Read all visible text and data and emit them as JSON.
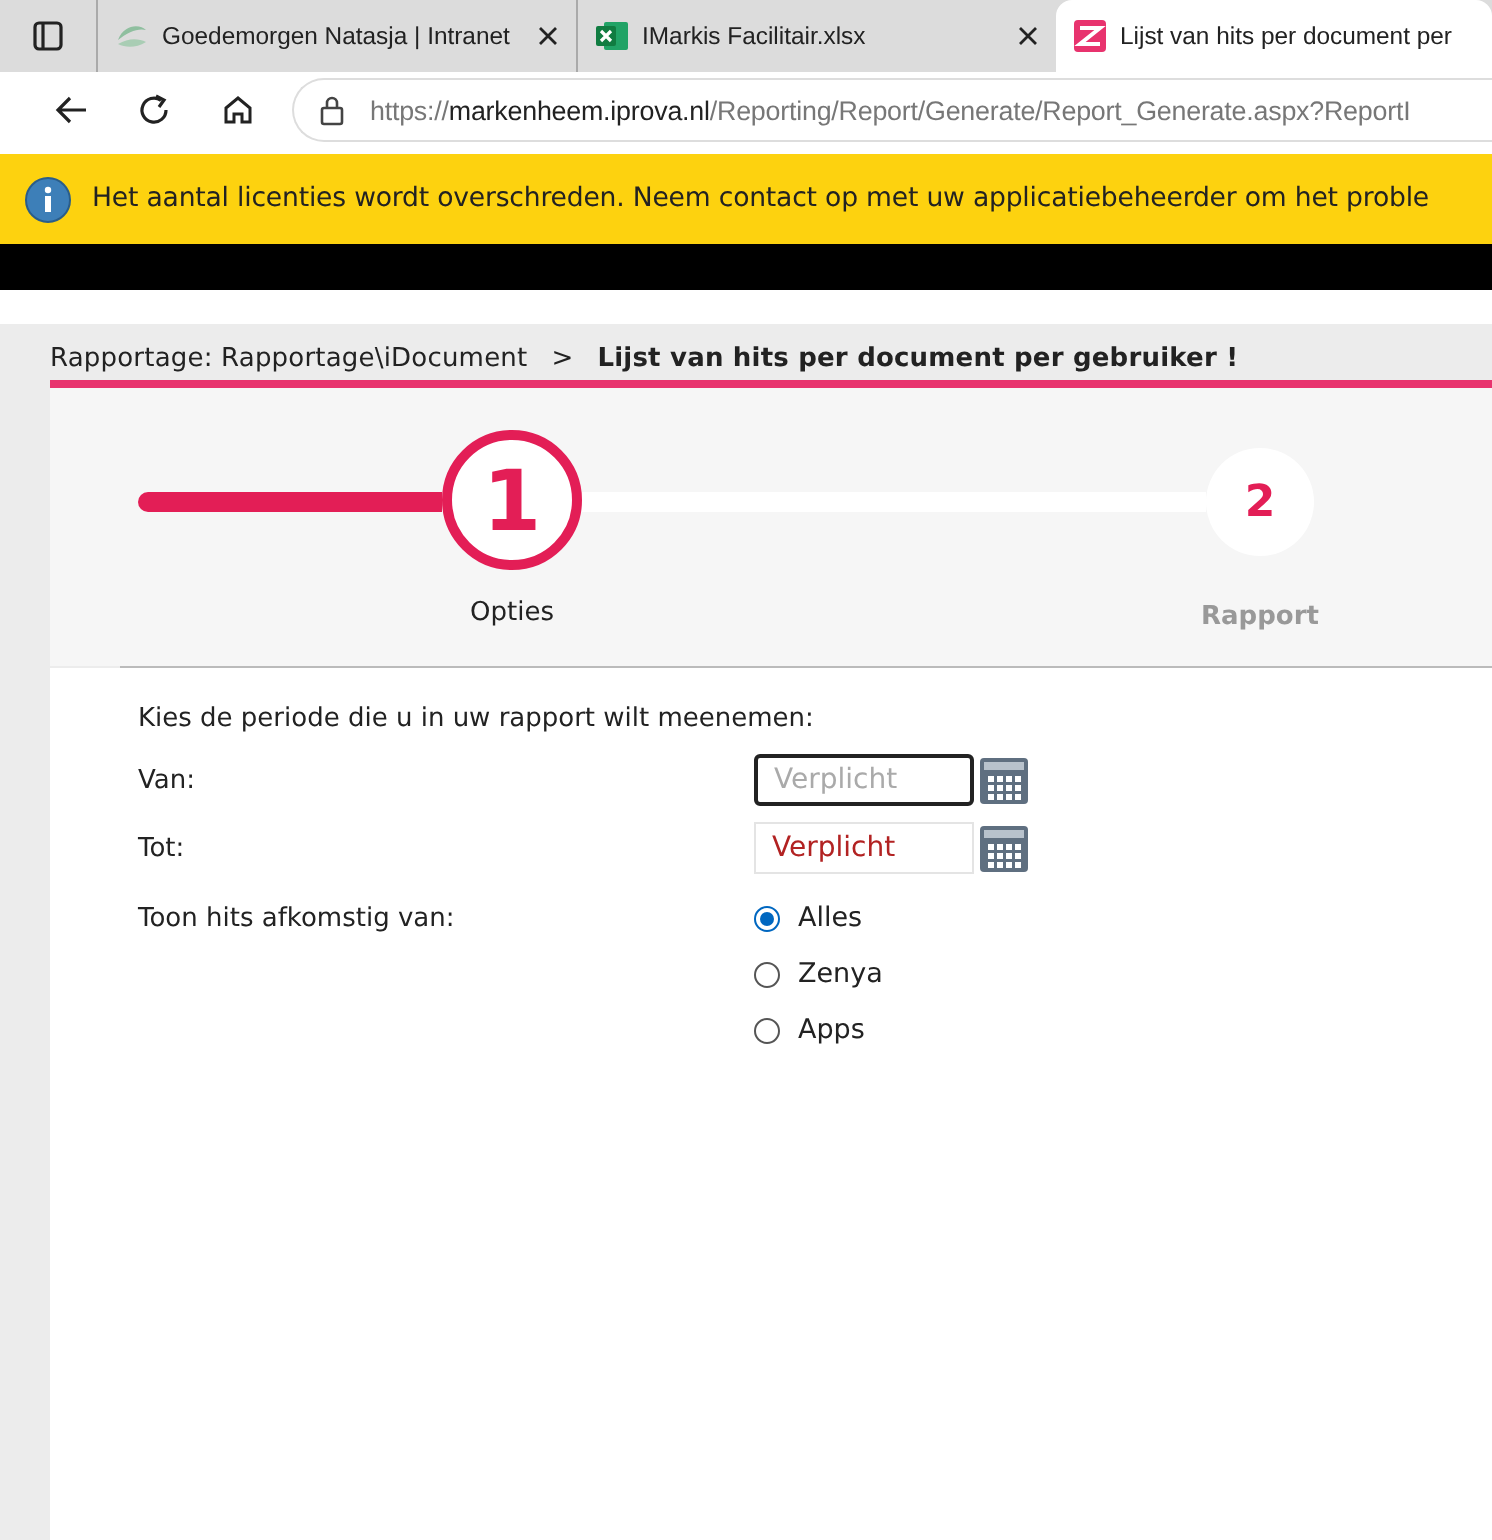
{
  "browser": {
    "tabs": [
      {
        "title": "Goedemorgen Natasja | Intranet",
        "selected": false
      },
      {
        "title": "IMarkis Facilitair.xlsx",
        "selected": false
      },
      {
        "title": "Lijst van hits per document per",
        "selected": true
      }
    ],
    "address": {
      "scheme": "https://",
      "host": "markenheem.iprova.nl",
      "path": "/Reporting/Report/Generate/Report_Generate.aspx?ReportI"
    }
  },
  "banner": {
    "message": "Het aantal licenties wordt overschreden. Neem contact op met uw applicatiebeheerder om het proble"
  },
  "breadcrumb": {
    "path": "Rapportage: Rapportage\\iDocument",
    "separator": ">",
    "current": "Lijst van hits per document per gebruiker !"
  },
  "steps": [
    {
      "number": "1",
      "label": "Opties",
      "selected": true
    },
    {
      "number": "2",
      "label": "Rapport",
      "selected": false
    }
  ],
  "form": {
    "intro": "Kies de periode die u in uw rapport wilt meenemen:",
    "fields": [
      {
        "label": "Van:",
        "placeholder": "Verplicht",
        "focused": true,
        "error": false
      },
      {
        "label": "Tot:",
        "placeholder": "Verplicht",
        "focused": false,
        "error": true
      }
    ],
    "source_label": "Toon hits afkomstig van:",
    "options": [
      {
        "label": "Alles",
        "selected": true
      },
      {
        "label": "Zenya",
        "selected": false
      },
      {
        "label": "Apps",
        "selected": false
      }
    ]
  }
}
